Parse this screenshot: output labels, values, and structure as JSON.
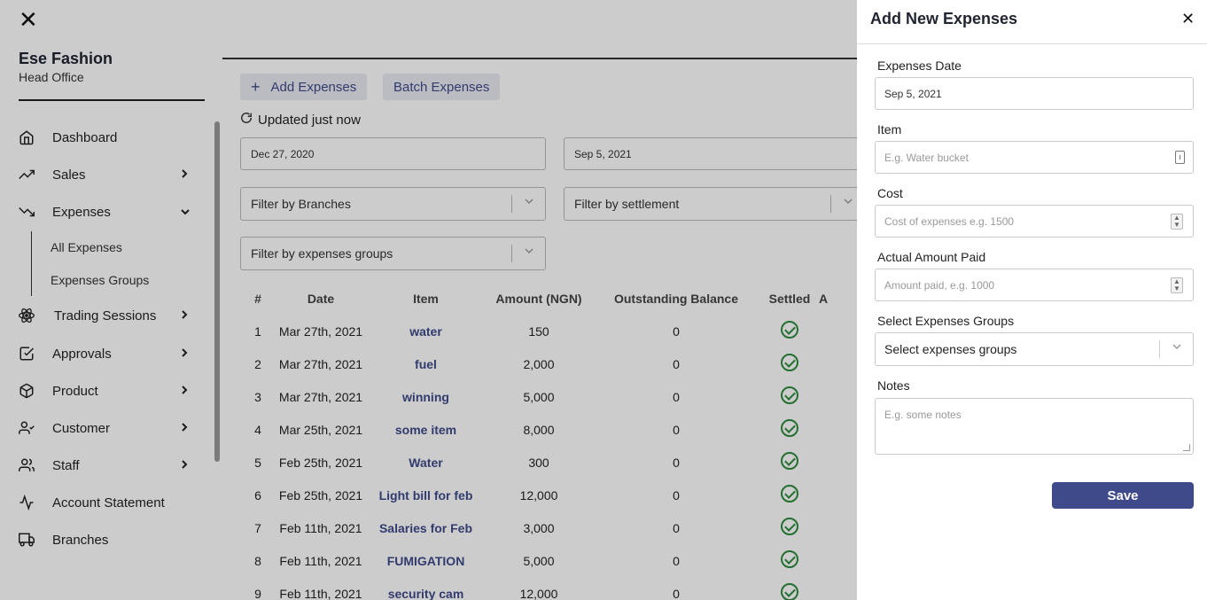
{
  "sidebar": {
    "close_glyph": "✕",
    "brand_name": "Ese Fashion",
    "brand_sub": "Head Office",
    "items": [
      {
        "label": "Dashboard",
        "icon": "home-icon",
        "chevron": ""
      },
      {
        "label": "Sales",
        "icon": "trending-up-icon",
        "chevron": "›"
      },
      {
        "label": "Expenses",
        "icon": "trending-down-icon",
        "chevron": "⌄"
      },
      {
        "label": "Trading Sessions",
        "icon": "atom-icon",
        "chevron": "›"
      },
      {
        "label": "Approvals",
        "icon": "check-square-icon",
        "chevron": "›"
      },
      {
        "label": "Product",
        "icon": "package-icon",
        "chevron": "›"
      },
      {
        "label": "Customer",
        "icon": "user-check-icon",
        "chevron": "›"
      },
      {
        "label": "Staff",
        "icon": "users-icon",
        "chevron": "›"
      },
      {
        "label": "Account Statement",
        "icon": "activity-icon",
        "chevron": ""
      },
      {
        "label": "Branches",
        "icon": "truck-icon",
        "chevron": ""
      }
    ],
    "sub_items": [
      "All Expenses",
      "Expenses Groups"
    ]
  },
  "main": {
    "add_expenses": "Add Expenses",
    "batch_expenses": "Batch Expenses",
    "updated": "Updated just now",
    "date_from": "Dec 27, 2020",
    "date_to": "Sep 5, 2021",
    "filter_branches": "Filter by Branches",
    "filter_settlement": "Filter by settlement",
    "filter_groups": "Filter by expenses groups",
    "table": {
      "headers": [
        "#",
        "Date",
        "Item",
        "Amount (NGN)",
        "Outstanding Balance",
        "Settled",
        "A"
      ],
      "rows": [
        [
          "1",
          "Mar 27th, 2021",
          "water",
          "150",
          "0"
        ],
        [
          "2",
          "Mar 27th, 2021",
          "fuel",
          "2,000",
          "0"
        ],
        [
          "3",
          "Mar 27th, 2021",
          "winning",
          "5,000",
          "0"
        ],
        [
          "4",
          "Mar 25th, 2021",
          "some item",
          "8,000",
          "0"
        ],
        [
          "5",
          "Feb 25th, 2021",
          "Water",
          "300",
          "0"
        ],
        [
          "6",
          "Feb 25th, 2021",
          "Light bill for feb",
          "12,000",
          "0"
        ],
        [
          "7",
          "Feb 11th, 2021",
          "Salaries for Feb",
          "3,000",
          "0"
        ],
        [
          "8",
          "Feb 11th, 2021",
          "FUMIGATION",
          "5,000",
          "0"
        ],
        [
          "9",
          "Feb 11th, 2021",
          "security cam",
          "12,000",
          "0"
        ]
      ]
    }
  },
  "drawer": {
    "title": "Add New Expenses",
    "close_glyph": "✕",
    "date_label": "Expenses Date",
    "date_value": "Sep 5, 2021",
    "item_label": "Item",
    "item_placeholder": "E.g. Water bucket",
    "cost_label": "Cost",
    "cost_placeholder": "Cost of expenses e.g. 1500",
    "paid_label": "Actual Amount Paid",
    "paid_placeholder": "Amount paid, e.g. 1000",
    "groups_label": "Select Expenses Groups",
    "groups_value": "Select expenses groups",
    "notes_label": "Notes",
    "notes_placeholder": "E.g. some notes",
    "save_label": "Save"
  },
  "colors": {
    "accent": "#3f4a8a",
    "success": "#2e8b3e"
  }
}
